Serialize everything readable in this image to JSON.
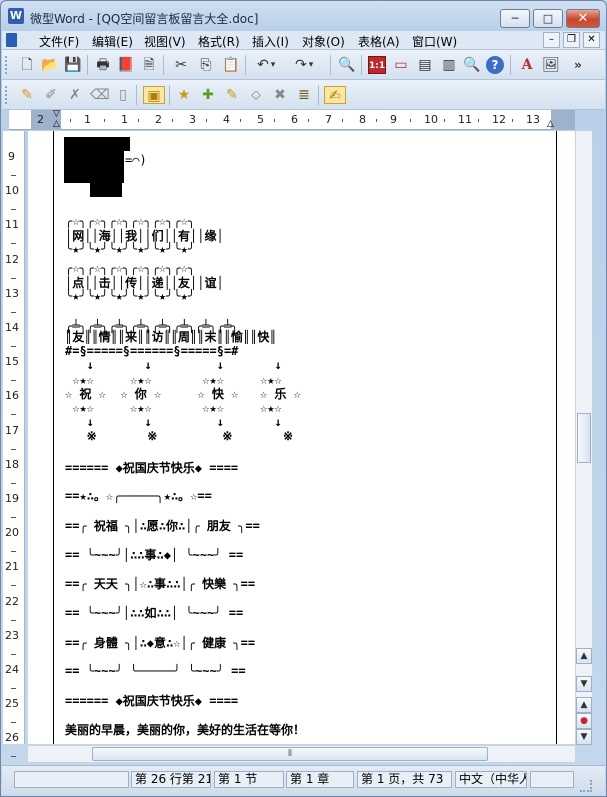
{
  "window": {
    "title": "微型Word - [QQ空间留言板留言大全.doc]",
    "app_icon": "W",
    "minimize": "─",
    "maximize": "□",
    "close": "✕"
  },
  "menu": {
    "items": [
      "文件(F)",
      "编辑(E)",
      "视图(V)",
      "格式(R)",
      "插入(I)",
      "对象(O)",
      "表格(A)",
      "窗口(W)"
    ],
    "mdi_min": "–",
    "mdi_restore": "❐",
    "mdi_close": "✕"
  },
  "toolbar1": {
    "icons": [
      "new-icon",
      "open-icon",
      "save-icon",
      "print-icon",
      "pdf-icon",
      "preview-icon",
      "cut-icon",
      "copy-icon",
      "paste-icon",
      "undo-icon",
      "redo-icon",
      "find-icon",
      "table-11-icon",
      "insert-frame-icon",
      "page-view-icon",
      "columns-icon",
      "zoom-icon",
      "help-icon",
      "text-color-icon",
      "picture-icon"
    ],
    "glyphs": [
      "🗋",
      "📂",
      "💾",
      "🖶",
      "📕",
      "🗎",
      "✂",
      "⎘",
      "📋",
      "↶",
      "↷",
      "🔍",
      "1:1",
      "▭",
      "▤",
      "▥",
      "🔍",
      "?",
      "A",
      "🖼"
    ],
    "more": "»"
  },
  "toolbar2": {
    "icons": [
      "note-icon",
      "edit-icon",
      "delete-icon",
      "eraser-icon",
      "page-icon",
      "active-tool-icon",
      "tag-star-icon",
      "tag-plus-icon",
      "tag-edit-icon",
      "tag-icon",
      "tag-del-icon",
      "list-icon",
      "marker-icon"
    ],
    "glyphs": [
      "✎",
      "✐",
      "✗",
      "⌫",
      "▯",
      "▣",
      "★",
      "✚",
      "✎",
      "⬦",
      "✖",
      "≣",
      "✍"
    ]
  },
  "ruler": {
    "tab_selector": "L",
    "numbers": [
      "2",
      "1",
      "1",
      "2",
      "3",
      "4",
      "5",
      "6",
      "7",
      "8",
      "9",
      "10",
      "11",
      "12",
      "13",
      "14"
    ]
  },
  "vruler": {
    "numbers": [
      "9",
      "10",
      "11",
      "12",
      "13",
      "14",
      "15",
      "16",
      "17",
      "18",
      "19",
      "20",
      "21",
      "22",
      "23",
      "24",
      "25",
      "26"
    ]
  },
  "document": {
    "lines": [
      "╭☆╮╭☆╮╭☆╮╭☆╮╭☆╮╭☆╮",
      "│网││海││我││们││有││缘│",
      "╰★╯╰★╯╰★╯╰★╯╰★╯╰★╯",
      "╭☆╮╭☆╮╭☆╮╭☆╮╭☆╮╭☆╮",
      "│点││击││传││递││友││谊│",
      "╰★╯╰★╯╰★╯╰★╯╰★╯╰★╯",
      "╭╧╮╭╧╮╭╧╮╭╧╮╭╧╮╭╧╮╭╧╮╭╧╮",
      "║友║║情║║来║║访║║周║║末║║愉║║快║",
      "#=§=====§======§=====§=#",
      "   ↓       ↓         ↓       ↓",
      " ☆★☆     ☆★☆       ☆★☆     ☆★☆",
      "☆ 祝 ☆  ☆ 你 ☆     ☆ 快 ☆   ☆ 乐 ☆",
      " ☆★☆     ☆★☆       ☆★☆     ☆★☆",
      "   ↓       ↓         ↓       ↓",
      "   ※       ※         ※       ※",
      "====== ◆祝国庆节快乐◆ ====",
      "==★∴。☆╭─────╮★∴。☆==",
      "==╭ 祝福 ╮│∴愿∴你∴│╭ 朋友 ╮==",
      "== ╰~~~╯│∴∴事∴◆│ ╰~~~╯ ==",
      "==╭ 天天 ╮│☆∴事∴∴│╭ 快樂 ╮==",
      "== ╰~~~╯│∴∴如∴∴│ ╰~~~╯ ==",
      "==╭ 身體 ╮│∴◆意∴☆│╭ 健康 ╮==",
      "== ╰~~~╯ ╰─────╯ ╰~~~╯ ==",
      "====== ◆祝国庆节快乐◆ ====",
      "美丽的早晨，美丽的你，美好的生活在等你！"
    ]
  },
  "hscroll": {
    "thumb": "⦀"
  },
  "vscroll": {
    "up": "▲",
    "down": "▼",
    "prev": "▲",
    "dot": "●",
    "next": "▼",
    "thumb_grip": "≡"
  },
  "status": {
    "position": "第 26 行第 21",
    "section": "第 1 节",
    "chapter": "第 1 章",
    "page": "第 1 页，共 73",
    "language": "中文（中华人"
  }
}
